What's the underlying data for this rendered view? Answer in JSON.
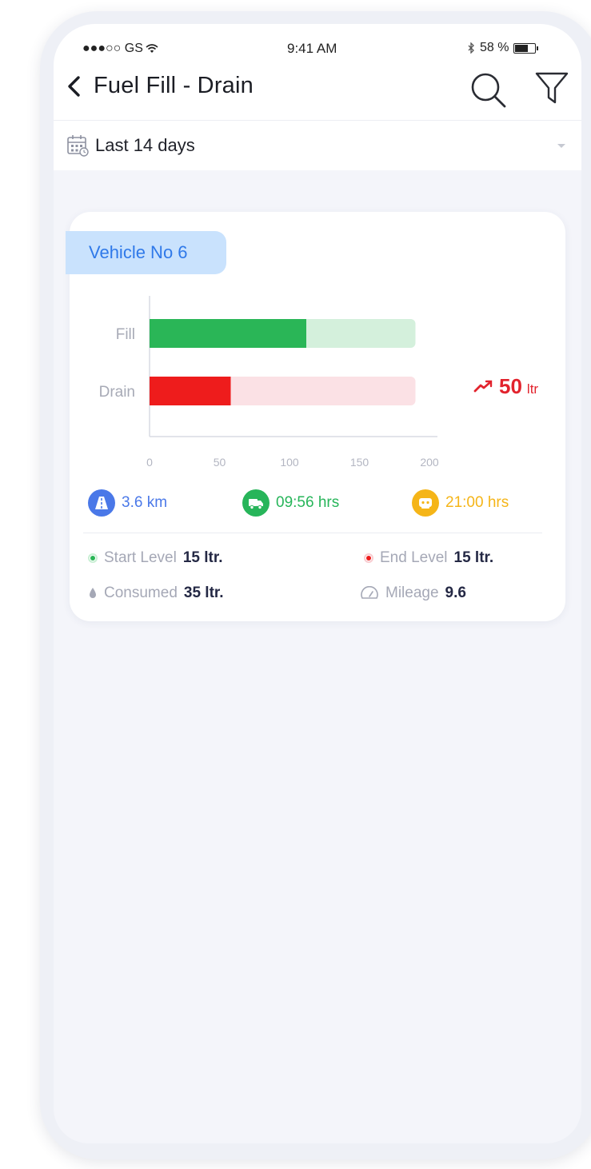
{
  "status_bar": {
    "carrier": "●●●○○ GS",
    "time": "9:41 AM",
    "battery": "58 %"
  },
  "header": {
    "title": "Fuel Fill - Drain"
  },
  "filter": {
    "date_range": "Last 14 days"
  },
  "card": {
    "vehicle": "Vehicle No 6",
    "trend_value": "50",
    "trend_unit": "ltr",
    "metrics": [
      {
        "value": "3.6 km",
        "icon": "road-icon",
        "color": "#4a78e8"
      },
      {
        "value": "09:56 hrs",
        "icon": "truck-icon",
        "color": "#27b55a"
      },
      {
        "value": "21:00 hrs",
        "icon": "idle-icon",
        "color": "#f5b518"
      }
    ],
    "stats": [
      {
        "label": "Start Level",
        "value": "15 ltr.",
        "icon": "green-dot-icon"
      },
      {
        "label": "End Level",
        "value": "15 ltr.",
        "icon": "red-dot-icon"
      },
      {
        "label": "Consumed",
        "value": "35 ltr.",
        "icon": "drop-icon"
      },
      {
        "label": "Mileage",
        "value": "9.6",
        "icon": "speedometer-icon"
      }
    ]
  },
  "chart_data": {
    "type": "bar",
    "orientation": "horizontal",
    "categories": [
      "Fill",
      "Drain"
    ],
    "values": [
      112,
      58
    ],
    "max_values": [
      190,
      190
    ],
    "xlim": [
      0,
      200
    ],
    "xticks": [
      0,
      50,
      100,
      150,
      200
    ],
    "colors": {
      "fill": "#2ab657",
      "fill_bg": "#d4f0dc",
      "drain": "#ee1c1c",
      "drain_bg": "#fbe1e5"
    },
    "grid": false
  }
}
